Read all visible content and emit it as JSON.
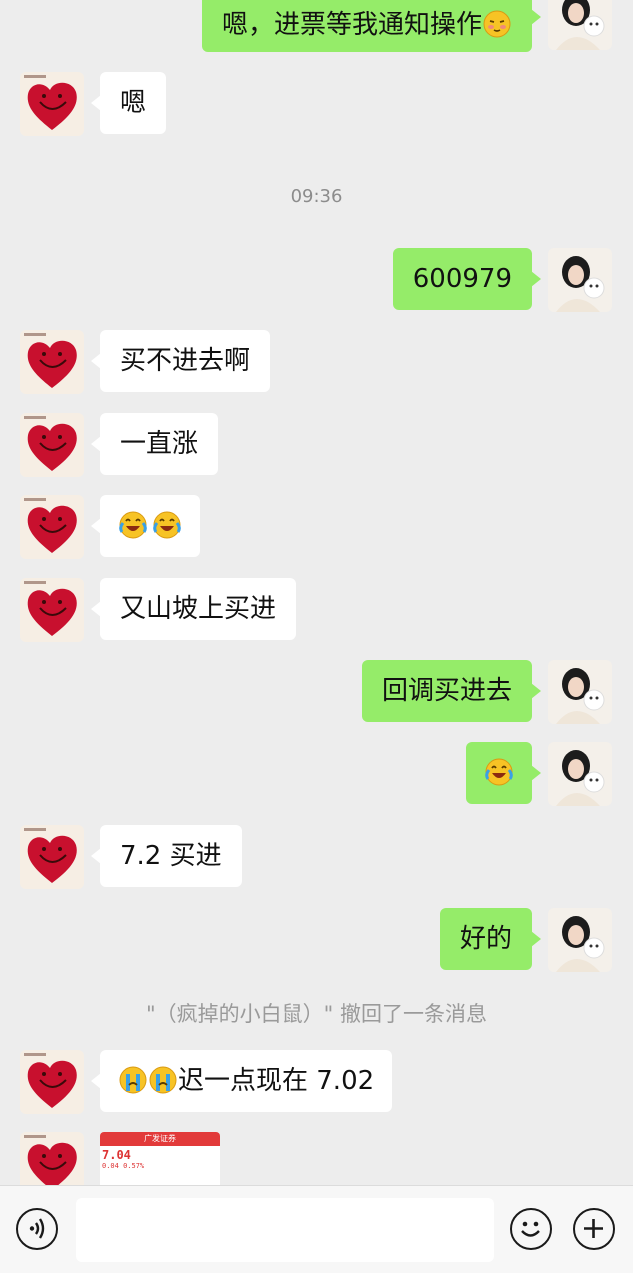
{
  "messages": {
    "m1": {
      "text": "嗯，进票等我通知操作"
    },
    "m2": {
      "text": "嗯"
    },
    "time1": "09:36",
    "m3": {
      "text": "600979"
    },
    "m4": {
      "text": "买不进去啊"
    },
    "m5": {
      "text": "一直涨"
    },
    "m6": {
      "emoji": "laugh-cry-emoji"
    },
    "m7": {
      "text": "又山坡上买进"
    },
    "m8": {
      "text": "回调买进去"
    },
    "m9": {
      "emoji": "laugh-cry-emoji"
    },
    "m10": {
      "text": "7.2 买进"
    },
    "m11": {
      "text": "好的"
    },
    "recall": "\"（疯掉的小白鼠）\" 撤回了一条消息",
    "m12": {
      "text": "迟一点现在 7.02"
    },
    "m13": {
      "thumb_price": "7.04",
      "thumb_change": "0.04  0.57%",
      "thumb_title": "广发证券"
    }
  },
  "input": {
    "placeholder": ""
  },
  "icons": {
    "voice": "voice-icon",
    "emoji": "emoji-face-icon",
    "plus": "plus-icon"
  },
  "colors": {
    "background": "#ededed",
    "self_bubble": "#95ec69",
    "other_bubble": "#ffffff"
  }
}
